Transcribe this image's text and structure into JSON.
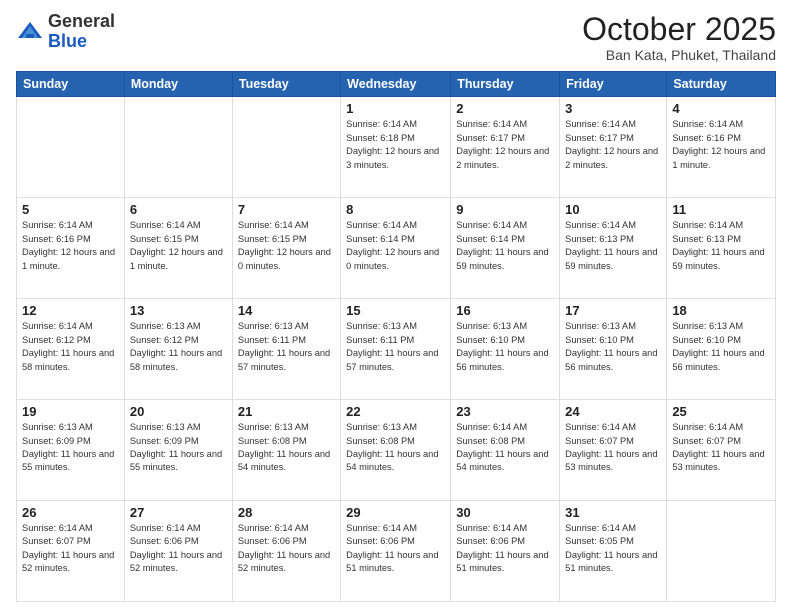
{
  "header": {
    "logo_general": "General",
    "logo_blue": "Blue",
    "month_title": "October 2025",
    "subtitle": "Ban Kata, Phuket, Thailand"
  },
  "days_of_week": [
    "Sunday",
    "Monday",
    "Tuesday",
    "Wednesday",
    "Thursday",
    "Friday",
    "Saturday"
  ],
  "weeks": [
    [
      {
        "day": "",
        "info": ""
      },
      {
        "day": "",
        "info": ""
      },
      {
        "day": "",
        "info": ""
      },
      {
        "day": "1",
        "info": "Sunrise: 6:14 AM\nSunset: 6:18 PM\nDaylight: 12 hours and 3 minutes."
      },
      {
        "day": "2",
        "info": "Sunrise: 6:14 AM\nSunset: 6:17 PM\nDaylight: 12 hours and 2 minutes."
      },
      {
        "day": "3",
        "info": "Sunrise: 6:14 AM\nSunset: 6:17 PM\nDaylight: 12 hours and 2 minutes."
      },
      {
        "day": "4",
        "info": "Sunrise: 6:14 AM\nSunset: 6:16 PM\nDaylight: 12 hours and 1 minute."
      }
    ],
    [
      {
        "day": "5",
        "info": "Sunrise: 6:14 AM\nSunset: 6:16 PM\nDaylight: 12 hours and 1 minute."
      },
      {
        "day": "6",
        "info": "Sunrise: 6:14 AM\nSunset: 6:15 PM\nDaylight: 12 hours and 1 minute."
      },
      {
        "day": "7",
        "info": "Sunrise: 6:14 AM\nSunset: 6:15 PM\nDaylight: 12 hours and 0 minutes."
      },
      {
        "day": "8",
        "info": "Sunrise: 6:14 AM\nSunset: 6:14 PM\nDaylight: 12 hours and 0 minutes."
      },
      {
        "day": "9",
        "info": "Sunrise: 6:14 AM\nSunset: 6:14 PM\nDaylight: 11 hours and 59 minutes."
      },
      {
        "day": "10",
        "info": "Sunrise: 6:14 AM\nSunset: 6:13 PM\nDaylight: 11 hours and 59 minutes."
      },
      {
        "day": "11",
        "info": "Sunrise: 6:14 AM\nSunset: 6:13 PM\nDaylight: 11 hours and 59 minutes."
      }
    ],
    [
      {
        "day": "12",
        "info": "Sunrise: 6:14 AM\nSunset: 6:12 PM\nDaylight: 11 hours and 58 minutes."
      },
      {
        "day": "13",
        "info": "Sunrise: 6:13 AM\nSunset: 6:12 PM\nDaylight: 11 hours and 58 minutes."
      },
      {
        "day": "14",
        "info": "Sunrise: 6:13 AM\nSunset: 6:11 PM\nDaylight: 11 hours and 57 minutes."
      },
      {
        "day": "15",
        "info": "Sunrise: 6:13 AM\nSunset: 6:11 PM\nDaylight: 11 hours and 57 minutes."
      },
      {
        "day": "16",
        "info": "Sunrise: 6:13 AM\nSunset: 6:10 PM\nDaylight: 11 hours and 56 minutes."
      },
      {
        "day": "17",
        "info": "Sunrise: 6:13 AM\nSunset: 6:10 PM\nDaylight: 11 hours and 56 minutes."
      },
      {
        "day": "18",
        "info": "Sunrise: 6:13 AM\nSunset: 6:10 PM\nDaylight: 11 hours and 56 minutes."
      }
    ],
    [
      {
        "day": "19",
        "info": "Sunrise: 6:13 AM\nSunset: 6:09 PM\nDaylight: 11 hours and 55 minutes."
      },
      {
        "day": "20",
        "info": "Sunrise: 6:13 AM\nSunset: 6:09 PM\nDaylight: 11 hours and 55 minutes."
      },
      {
        "day": "21",
        "info": "Sunrise: 6:13 AM\nSunset: 6:08 PM\nDaylight: 11 hours and 54 minutes."
      },
      {
        "day": "22",
        "info": "Sunrise: 6:13 AM\nSunset: 6:08 PM\nDaylight: 11 hours and 54 minutes."
      },
      {
        "day": "23",
        "info": "Sunrise: 6:14 AM\nSunset: 6:08 PM\nDaylight: 11 hours and 54 minutes."
      },
      {
        "day": "24",
        "info": "Sunrise: 6:14 AM\nSunset: 6:07 PM\nDaylight: 11 hours and 53 minutes."
      },
      {
        "day": "25",
        "info": "Sunrise: 6:14 AM\nSunset: 6:07 PM\nDaylight: 11 hours and 53 minutes."
      }
    ],
    [
      {
        "day": "26",
        "info": "Sunrise: 6:14 AM\nSunset: 6:07 PM\nDaylight: 11 hours and 52 minutes."
      },
      {
        "day": "27",
        "info": "Sunrise: 6:14 AM\nSunset: 6:06 PM\nDaylight: 11 hours and 52 minutes."
      },
      {
        "day": "28",
        "info": "Sunrise: 6:14 AM\nSunset: 6:06 PM\nDaylight: 11 hours and 52 minutes."
      },
      {
        "day": "29",
        "info": "Sunrise: 6:14 AM\nSunset: 6:06 PM\nDaylight: 11 hours and 51 minutes."
      },
      {
        "day": "30",
        "info": "Sunrise: 6:14 AM\nSunset: 6:06 PM\nDaylight: 11 hours and 51 minutes."
      },
      {
        "day": "31",
        "info": "Sunrise: 6:14 AM\nSunset: 6:05 PM\nDaylight: 11 hours and 51 minutes."
      },
      {
        "day": "",
        "info": ""
      }
    ]
  ]
}
